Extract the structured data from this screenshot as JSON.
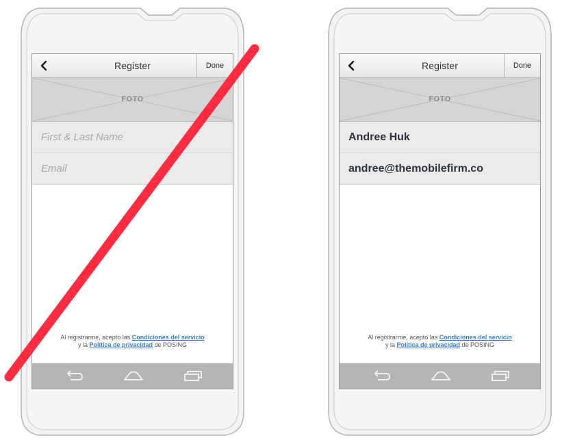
{
  "colors": {
    "slash": "#ff2b40",
    "link": "#3c7cc4",
    "navbar": "#b5b5b5"
  },
  "screens": [
    {
      "state": "empty",
      "header": {
        "back_icon": "chevron-left-icon",
        "title": "Register",
        "done_label": "Done"
      },
      "photo_label": "FOTO",
      "name_field": {
        "placeholder": "First & Last Name",
        "value": ""
      },
      "email_field": {
        "placeholder": "Email",
        "value": ""
      },
      "legal": {
        "line1_prefix": "Al registrarme, acepto las",
        "terms_link": "Condiciones del servicio",
        "line2_prefix": "y la",
        "privacy_link": "Política de privacidad",
        "line2_suffix": "de POSING"
      },
      "navbar": {
        "icons": [
          "back-arrow-icon",
          "home-icon",
          "recent-apps-icon"
        ]
      }
    },
    {
      "state": "filled",
      "header": {
        "back_icon": "chevron-left-icon",
        "title": "Register",
        "done_label": "Done"
      },
      "photo_label": "FOTO",
      "name_field": {
        "value": "Andree Huk"
      },
      "email_field": {
        "value": "andree@themobilefirm.co"
      },
      "legal": {
        "line1_prefix": "Al registrarme, acepto las",
        "terms_link": "Condiciones del servicio",
        "line2_prefix": "y la",
        "privacy_link": "Política de privacidad",
        "line2_suffix": "de POSING"
      },
      "navbar": {
        "icons": [
          "back-arrow-icon",
          "home-icon",
          "recent-apps-icon"
        ]
      }
    }
  ]
}
